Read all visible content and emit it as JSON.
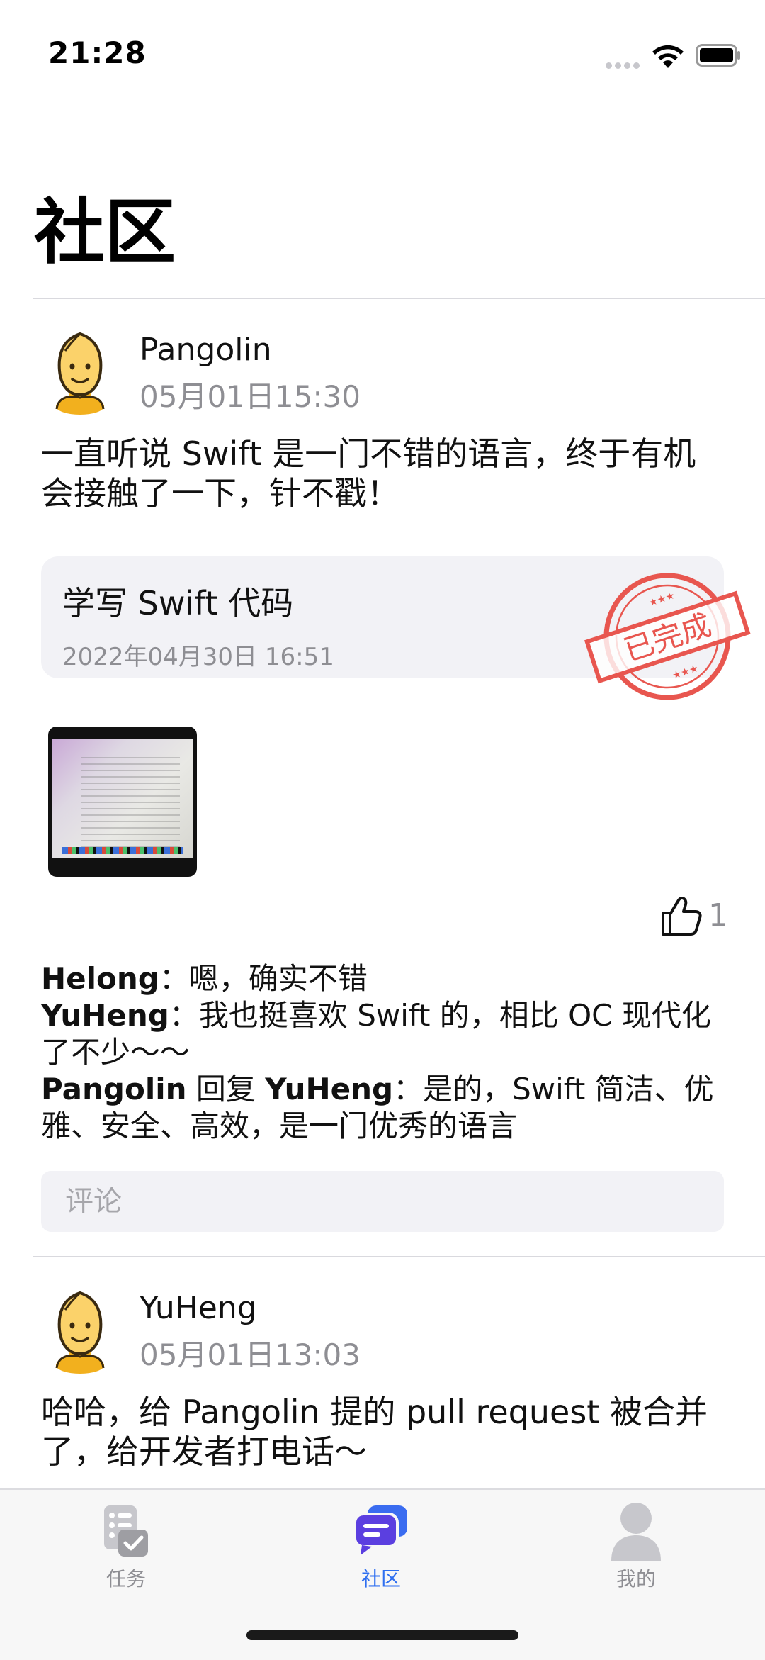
{
  "status_bar": {
    "time": "21:28"
  },
  "page": {
    "title": "社区"
  },
  "posts": [
    {
      "author": "Pangolin",
      "time": "05月01日15:30",
      "text": "一直听说 Swift 是一门不错的语言，终于有机会接触了一下，针不戳！",
      "task": {
        "title": "学写 Swift 代码",
        "date": "2022年04月30日 16:51",
        "stamp": "已完成"
      },
      "likes": "1",
      "comments": [
        {
          "author": "Helong",
          "reply_word": "",
          "reply_to": "",
          "sep": "：",
          "text": "嗯，确实不错"
        },
        {
          "author": "YuHeng",
          "reply_word": "",
          "reply_to": "",
          "sep": "：",
          "text": "我也挺喜欢 Swift 的，相比 OC 现代化了不少～～"
        },
        {
          "author": "Pangolin",
          "reply_word": " 回复 ",
          "reply_to": "YuHeng",
          "sep": "：",
          "text": "是的，Swift 简洁、优雅、安全、高效，是一门优秀的语言"
        }
      ],
      "comment_placeholder": "评论"
    },
    {
      "author": "YuHeng",
      "time": "05月01日13:03",
      "text": "哈哈，给 Pangolin 提的 pull request 被合并了，给开发者打电话～"
    }
  ],
  "tab_bar": {
    "tabs": [
      {
        "label": "任务",
        "icon": "tasks-icon"
      },
      {
        "label": "社区",
        "icon": "chat-bubbles-icon",
        "active": true
      },
      {
        "label": "我的",
        "icon": "person-icon"
      }
    ],
    "active_color": "#2f6ff0",
    "inactive_color": "#8e8e93"
  },
  "colors": {
    "stamp": "#e8564f",
    "secondary_text": "#8e8e93",
    "card_bg": "#f2f2f6"
  }
}
